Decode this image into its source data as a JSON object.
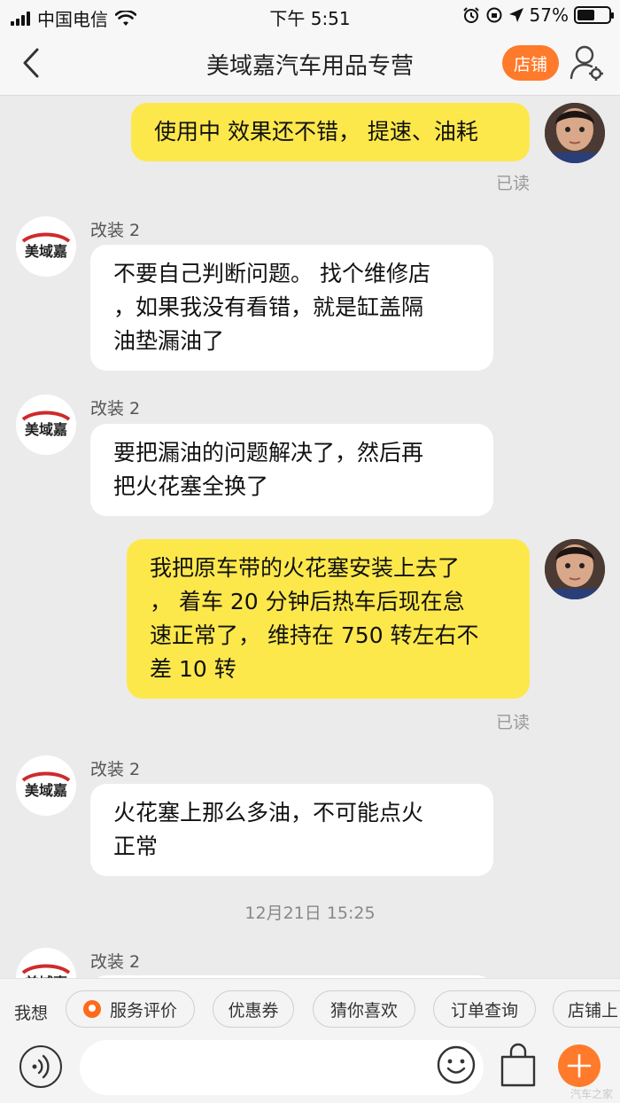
{
  "status_bar": {
    "carrier": "中国电信",
    "time": "下午 5:51",
    "battery": "57%",
    "battery_level": 0.57
  },
  "nav": {
    "title": "美域嘉汽车用品专营",
    "shop_button": "店铺"
  },
  "chat": {
    "shop_logo_text": "美域嘉",
    "messages": [
      {
        "from": "me",
        "text": "使用中 效果还不错， 提速、油耗",
        "status": "已读"
      },
      {
        "from": "shop",
        "sender": "改装 2",
        "lines": [
          "不要自己判断问题。 找个维修店",
          "，如果我没有看错，就是缸盖隔",
          "油垫漏油了"
        ]
      },
      {
        "from": "shop",
        "sender": "改装 2",
        "lines": [
          "要把漏油的问题解决了，然后再",
          "把火花塞全换了"
        ]
      },
      {
        "from": "me",
        "lines": [
          "我把原车带的火花塞安装上去了",
          "，  着车 20 分钟后热车后现在怠",
          "速正常了，  维持在 750 转左右不",
          "差 10 转"
        ],
        "status": "已读"
      },
      {
        "from": "shop",
        "sender": "改装 2",
        "lines": [
          "火花塞上那么多油，不可能点火",
          "正常"
        ]
      },
      {
        "from": "shop",
        "sender": "改装 2",
        "lines": []
      }
    ],
    "timestamp": "12月21日 15:25"
  },
  "quick_bar": {
    "label": "我想",
    "chips": [
      "服务评价",
      "优惠券",
      "猜你喜欢",
      "订单查询",
      "店铺上"
    ]
  },
  "input_bar": {
    "placeholder": ""
  },
  "watermark": "汽车之家",
  "colors": {
    "accent": "#ff7a2a",
    "my_bubble": "#fde84c",
    "shop_bubble": "#ffffff",
    "background": "#ebebeb"
  },
  "icons": [
    "back-icon",
    "wifi-icon",
    "alarm-icon",
    "location-icon",
    "user-settings-icon",
    "voice-icon",
    "emoji-icon",
    "shopping-bag-icon",
    "plus-icon"
  ]
}
